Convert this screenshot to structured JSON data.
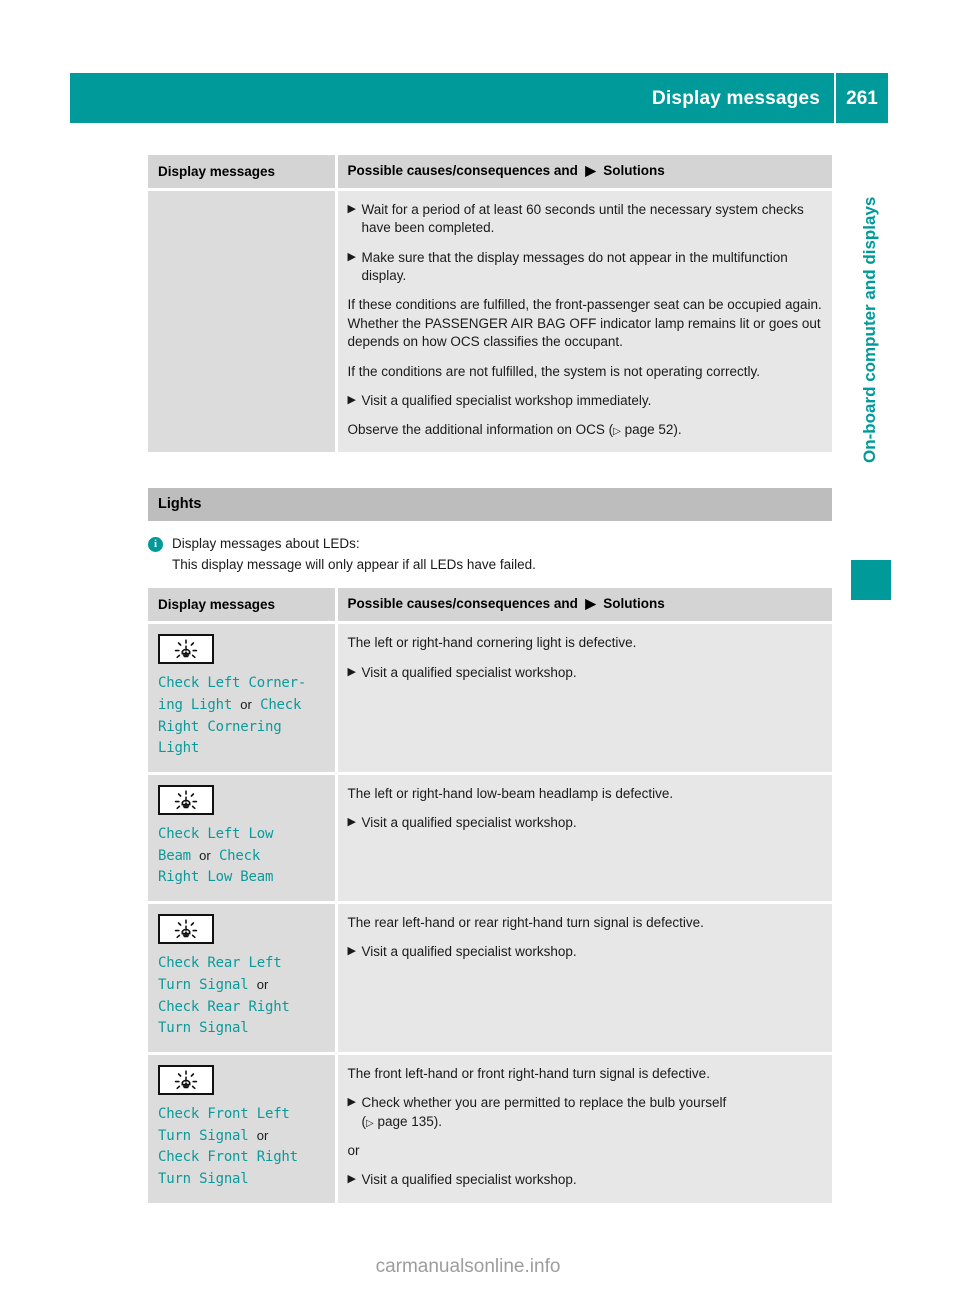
{
  "header": {
    "title": "Display messages",
    "page_number": "261",
    "accent_color": "#009a9a"
  },
  "side_tab": {
    "label": "On-board computer and displays"
  },
  "table_top": {
    "headers": {
      "col1": "Display messages",
      "col2_before": "Possible causes/consequences and",
      "col2_after": "Solutions"
    },
    "rows": [
      {
        "left": "",
        "blocks": [
          {
            "type": "bullet",
            "text": "Wait for a period of at least 60 seconds until the necessary system checks have been completed."
          },
          {
            "type": "bullet",
            "text": "Make sure that the display messages do not appear in the multifunction display."
          },
          {
            "type": "para",
            "text": "If these conditions are fulfilled, the front-passenger seat can be occupied again. Whether the PASSENGER AIR BAG OFF indicator lamp remains lit or goes out depends on how OCS classifies the occupant."
          },
          {
            "type": "para",
            "text": "If the conditions are not fulfilled, the system is not operating correctly."
          },
          {
            "type": "bullet",
            "text": "Visit a qualified specialist workshop immediately."
          },
          {
            "type": "para_ref",
            "text_before": "Observe the additional information on OCS (",
            "ref": " page 52",
            "text_after": ")."
          }
        ]
      }
    ]
  },
  "lights_section": {
    "heading": "Lights",
    "note": {
      "icon": "info-icon",
      "line1": "Display messages about LEDs:",
      "line2": "This display message will only appear if all LEDs have failed."
    },
    "table": {
      "headers": {
        "col1": "Display messages",
        "col2_before": "Possible causes/consequences and",
        "col2_after": "Solutions"
      },
      "rows": [
        {
          "icon": "bulb-warning-icon",
          "message_parts": [
            {
              "kind": "msg",
              "text": "Check Left Corner-"
            },
            {
              "kind": "msg",
              "text": "ing Light"
            },
            {
              "kind": "or",
              "text": "or"
            },
            {
              "kind": "msg",
              "text": "Check"
            },
            {
              "kind": "msg",
              "text": "Right Cornering"
            },
            {
              "kind": "msg",
              "text": "Light"
            }
          ],
          "message_lines": [
            [
              {
                "kind": "msg",
                "text": "Check Left Corner-"
              }
            ],
            [
              {
                "kind": "msg",
                "text": "ing Light"
              },
              {
                "kind": "or",
                "text": "or"
              },
              {
                "kind": "msg",
                "text": "Check"
              }
            ],
            [
              {
                "kind": "msg",
                "text": "Right Cornering"
              }
            ],
            [
              {
                "kind": "msg",
                "text": "Light"
              }
            ]
          ],
          "blocks": [
            {
              "type": "para",
              "text": "The left or right-hand cornering light is defective."
            },
            {
              "type": "bullet",
              "text": "Visit a qualified specialist workshop."
            }
          ]
        },
        {
          "icon": "bulb-warning-icon",
          "message_lines": [
            [
              {
                "kind": "msg",
                "text": "Check Left Low"
              }
            ],
            [
              {
                "kind": "msg",
                "text": "Beam"
              },
              {
                "kind": "or",
                "text": "or"
              },
              {
                "kind": "msg",
                "text": "Check"
              }
            ],
            [
              {
                "kind": "msg",
                "text": "Right Low Beam"
              }
            ]
          ],
          "blocks": [
            {
              "type": "para",
              "text": "The left or right-hand low-beam headlamp is defective."
            },
            {
              "type": "bullet",
              "text": "Visit a qualified specialist workshop."
            }
          ]
        },
        {
          "icon": "bulb-warning-icon",
          "message_lines": [
            [
              {
                "kind": "msg",
                "text": "Check Rear Left"
              }
            ],
            [
              {
                "kind": "msg",
                "text": "Turn Signal"
              },
              {
                "kind": "or",
                "text": "or"
              }
            ],
            [
              {
                "kind": "msg",
                "text": "Check Rear Right"
              }
            ],
            [
              {
                "kind": "msg",
                "text": "Turn Signal"
              }
            ]
          ],
          "blocks": [
            {
              "type": "para",
              "text": "The rear left-hand or rear right-hand turn signal is defective."
            },
            {
              "type": "bullet",
              "text": "Visit a qualified specialist workshop."
            }
          ]
        },
        {
          "icon": "bulb-warning-icon",
          "message_lines": [
            [
              {
                "kind": "msg",
                "text": "Check Front Left"
              }
            ],
            [
              {
                "kind": "msg",
                "text": "Turn Signal"
              },
              {
                "kind": "or",
                "text": "or"
              }
            ],
            [
              {
                "kind": "msg",
                "text": "Check Front Right"
              }
            ],
            [
              {
                "kind": "msg",
                "text": "Turn Signal"
              }
            ]
          ],
          "blocks": [
            {
              "type": "para",
              "text": "The front left-hand or front right-hand turn signal is defective."
            },
            {
              "type": "bullet_ref",
              "text": "Check whether you are permitted to replace the bulb yourself",
              "ref_before": "(",
              "ref": " page 135",
              "ref_after": ")."
            },
            {
              "type": "para",
              "text": "or"
            },
            {
              "type": "bullet",
              "text": "Visit a qualified specialist workshop."
            }
          ]
        }
      ]
    }
  },
  "watermark": "carmanualsonline.info"
}
